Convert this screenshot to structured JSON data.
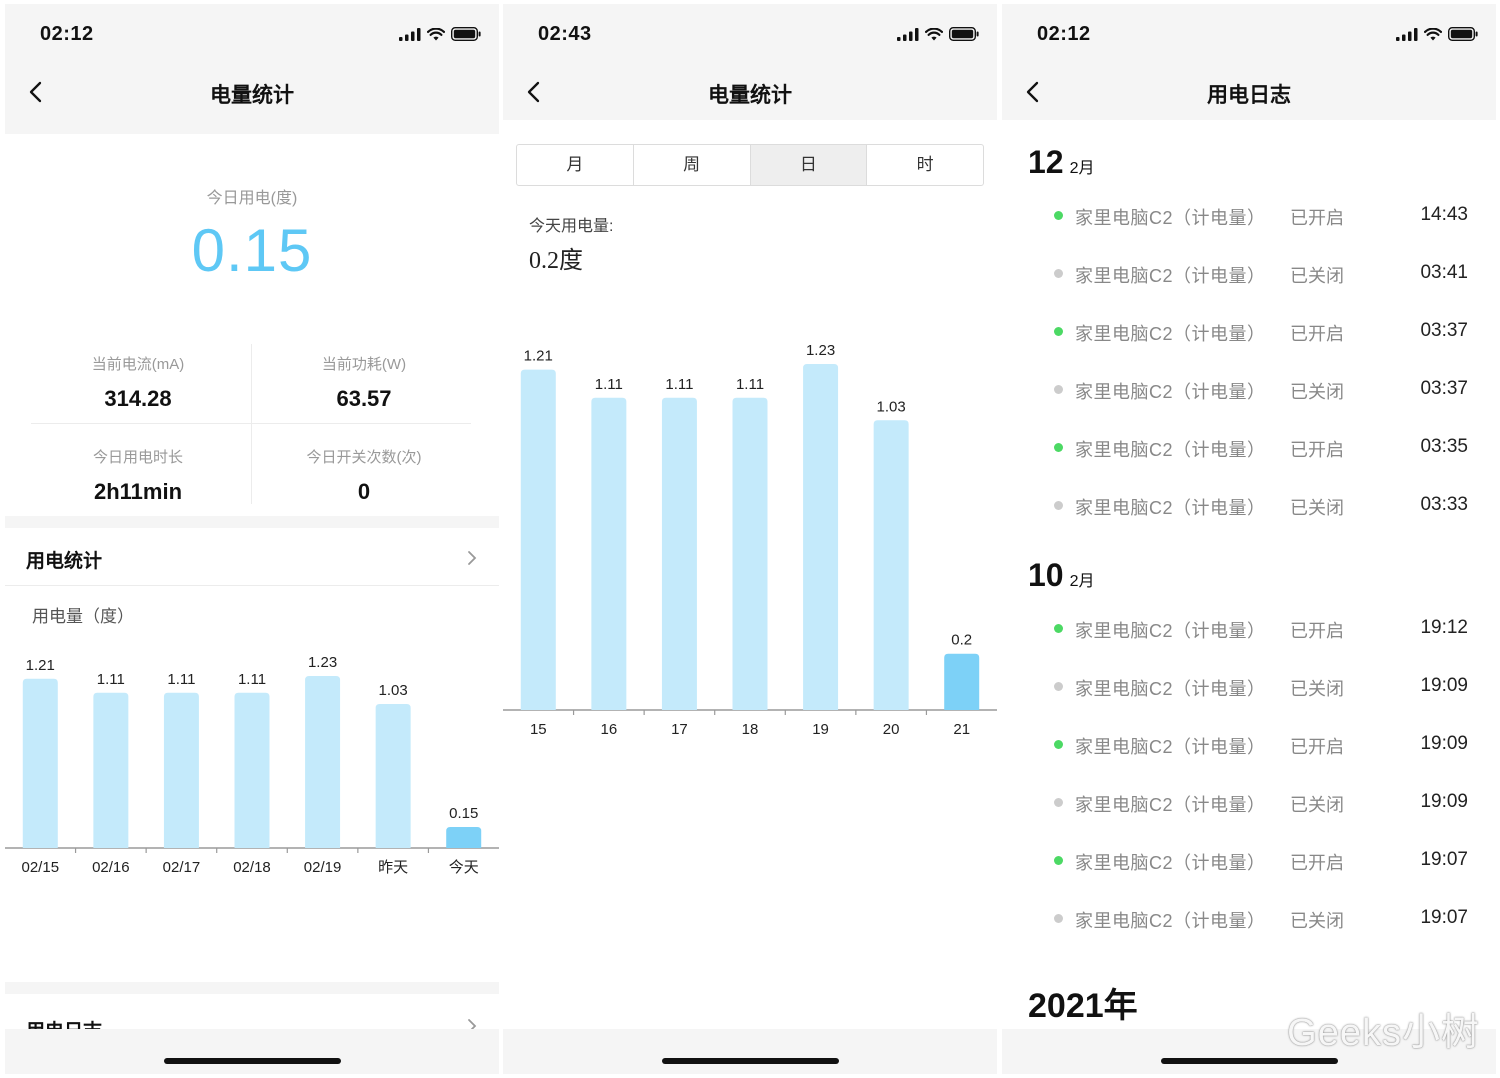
{
  "colors": {
    "accent": "#5ec8f5",
    "bar": "#c4eafb",
    "bar_today": "#7dd1f7",
    "green_dot": "#4cd964",
    "gray_dot": "#cccccc"
  },
  "screen1": {
    "time": "02:12",
    "title": "电量统计",
    "today_label": "今日用电(度)",
    "today_value": "0.15",
    "stats": [
      {
        "label": "当前电流(mA)",
        "value": "314.28"
      },
      {
        "label": "当前功耗(W)",
        "value": "63.57"
      },
      {
        "label": "今日用电时长",
        "value": "2h11min"
      },
      {
        "label": "今日开关次数(次)",
        "value": "0"
      }
    ],
    "section_stats": "用电统计",
    "chart_ylabel": "用电量（度）",
    "section_log": "用电日志"
  },
  "screen2": {
    "time": "02:43",
    "title": "电量统计",
    "tabs": [
      "月",
      "周",
      "日",
      "时"
    ],
    "active_tab": "日",
    "today_label": "今天用电量:",
    "today_value": "0.2度"
  },
  "screen3": {
    "time": "02:12",
    "title": "用电日志",
    "groups": [
      {
        "day": "12",
        "month": "2月",
        "entries": [
          {
            "device": "家里电脑C2（计电量）",
            "status": "已开启",
            "time": "14:43",
            "on": true
          },
          {
            "device": "家里电脑C2（计电量）",
            "status": "已关闭",
            "time": "03:41",
            "on": false
          },
          {
            "device": "家里电脑C2（计电量）",
            "status": "已开启",
            "time": "03:37",
            "on": true
          },
          {
            "device": "家里电脑C2（计电量）",
            "status": "已关闭",
            "time": "03:37",
            "on": false
          },
          {
            "device": "家里电脑C2（计电量）",
            "status": "已开启",
            "time": "03:35",
            "on": true
          },
          {
            "device": "家里电脑C2（计电量）",
            "status": "已关闭",
            "time": "03:33",
            "on": false
          }
        ]
      },
      {
        "day": "10",
        "month": "2月",
        "entries": [
          {
            "device": "家里电脑C2（计电量）",
            "status": "已开启",
            "time": "19:12",
            "on": true
          },
          {
            "device": "家里电脑C2（计电量）",
            "status": "已关闭",
            "time": "19:09",
            "on": false
          },
          {
            "device": "家里电脑C2（计电量）",
            "status": "已开启",
            "time": "19:09",
            "on": true
          },
          {
            "device": "家里电脑C2（计电量）",
            "status": "已关闭",
            "time": "19:09",
            "on": false
          },
          {
            "device": "家里电脑C2（计电量）",
            "status": "已开启",
            "time": "19:07",
            "on": true
          },
          {
            "device": "家里电脑C2（计电量）",
            "status": "已关闭",
            "time": "19:07",
            "on": false
          }
        ]
      }
    ],
    "year_header": "2021年",
    "watermark": "Geeks小树"
  },
  "chart_data": [
    {
      "type": "bar",
      "categories": [
        "02/15",
        "02/16",
        "02/17",
        "02/18",
        "02/19",
        "昨天",
        "今天"
      ],
      "values": [
        1.21,
        1.11,
        1.11,
        1.11,
        1.23,
        1.03,
        0.15
      ],
      "title": "",
      "ylabel": "用电量（度）",
      "ylim": [
        0,
        1.23
      ],
      "grid": false
    },
    {
      "type": "bar",
      "categories": [
        "15",
        "16",
        "17",
        "18",
        "19",
        "20",
        "21"
      ],
      "values": [
        1.21,
        1.11,
        1.11,
        1.11,
        1.23,
        1.03,
        0.2
      ],
      "title": "",
      "ylim": [
        0,
        1.23
      ],
      "grid": false
    }
  ]
}
